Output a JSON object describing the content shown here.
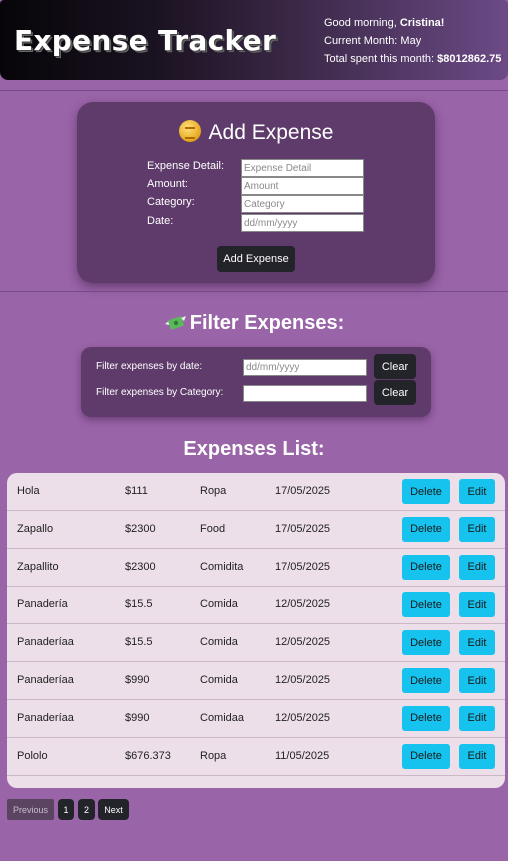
{
  "header": {
    "title": "Expense Tracker",
    "greeting_prefix": "Good morning, ",
    "user_name": "Cristina!",
    "month_line": "Current Month: May",
    "total_prefix": "Total spent this month: ",
    "total_value": "$8012862.75"
  },
  "add_form": {
    "title": "Add Expense",
    "icon": "coin-icon",
    "fields": [
      {
        "label": "Expense Detail:",
        "placeholder": "Expense Detail",
        "value": ""
      },
      {
        "label": "Amount:",
        "placeholder": "Amount",
        "value": ""
      },
      {
        "label": "Category:",
        "placeholder": "Category",
        "value": ""
      },
      {
        "label": "Date:",
        "placeholder": "dd/mm/yyyy",
        "value": ""
      }
    ],
    "submit_label": "Add Expense"
  },
  "filter": {
    "title": "Filter Expenses:",
    "icon": "money-with-wings-icon",
    "date_label": "Filter expenses by date:",
    "date_placeholder": "dd/mm/yyyy",
    "category_label": "Filter expenses by Category:",
    "category_placeholder": "",
    "clear_label": "Clear"
  },
  "list": {
    "title": "Expenses List:",
    "delete_label": "Delete",
    "edit_label": "Edit",
    "rows": [
      {
        "detail": "Hola",
        "amount": "$111",
        "category": "Ropa",
        "date": "17/05/2025"
      },
      {
        "detail": "Zapallo",
        "amount": "$2300",
        "category": "Food",
        "date": "17/05/2025"
      },
      {
        "detail": "Zapallito",
        "amount": "$2300",
        "category": "Comidita",
        "date": "17/05/2025"
      },
      {
        "detail": "Panadería",
        "amount": "$15.5",
        "category": "Comida",
        "date": "12/05/2025"
      },
      {
        "detail": "Panaderíaa",
        "amount": "$15.5",
        "category": "Comida",
        "date": "12/05/2025"
      },
      {
        "detail": "Panaderíaa",
        "amount": "$990",
        "category": "Comida",
        "date": "12/05/2025"
      },
      {
        "detail": "Panaderíaa",
        "amount": "$990",
        "category": "Comidaa",
        "date": "12/05/2025"
      },
      {
        "detail": "Pololo",
        "amount": "$676.373",
        "category": "Ropa",
        "date": "11/05/2025"
      }
    ]
  },
  "pagination": {
    "previous_label": "Previous",
    "pages": [
      "1",
      "2"
    ],
    "next_label": "Next"
  },
  "colors": {
    "background": "#9a64a8",
    "card": "#5e3b6a",
    "accent_button": "#16c3ee",
    "dark_button": "#23232a"
  }
}
